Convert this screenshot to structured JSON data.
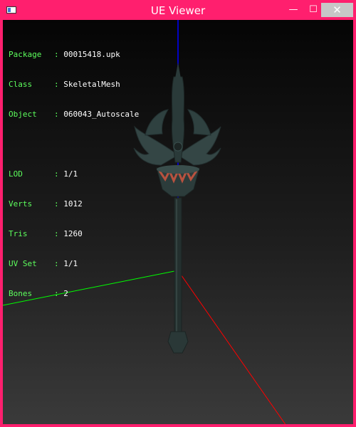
{
  "window": {
    "title": "UE Viewer",
    "controls": {
      "minimize": "—",
      "maximize": "☐",
      "close": "✕"
    },
    "frame_color": "#ff1f6e"
  },
  "info": {
    "package_label": "Package",
    "package_value": "00015418.upk",
    "class_label": "Class",
    "class_value": "SkeletalMesh",
    "object_label": "Object",
    "object_value": "060043_Autoscale",
    "lod_label": "LOD",
    "lod_value": "1/1",
    "verts_label": "Verts",
    "verts_value": "1012",
    "tris_label": "Tris",
    "tris_value": "1260",
    "uvset_label": "UV Set",
    "uvset_value": "1/1",
    "bones_label": "Bones",
    "bones_value": "2",
    "separator": ":"
  },
  "colors": {
    "label": "#5dff5d",
    "value": "#ffffff",
    "axis_x": "#ff0000",
    "axis_y": "#00ff00",
    "axis_z": "#0000ff",
    "mesh": "#2b3b3a"
  }
}
